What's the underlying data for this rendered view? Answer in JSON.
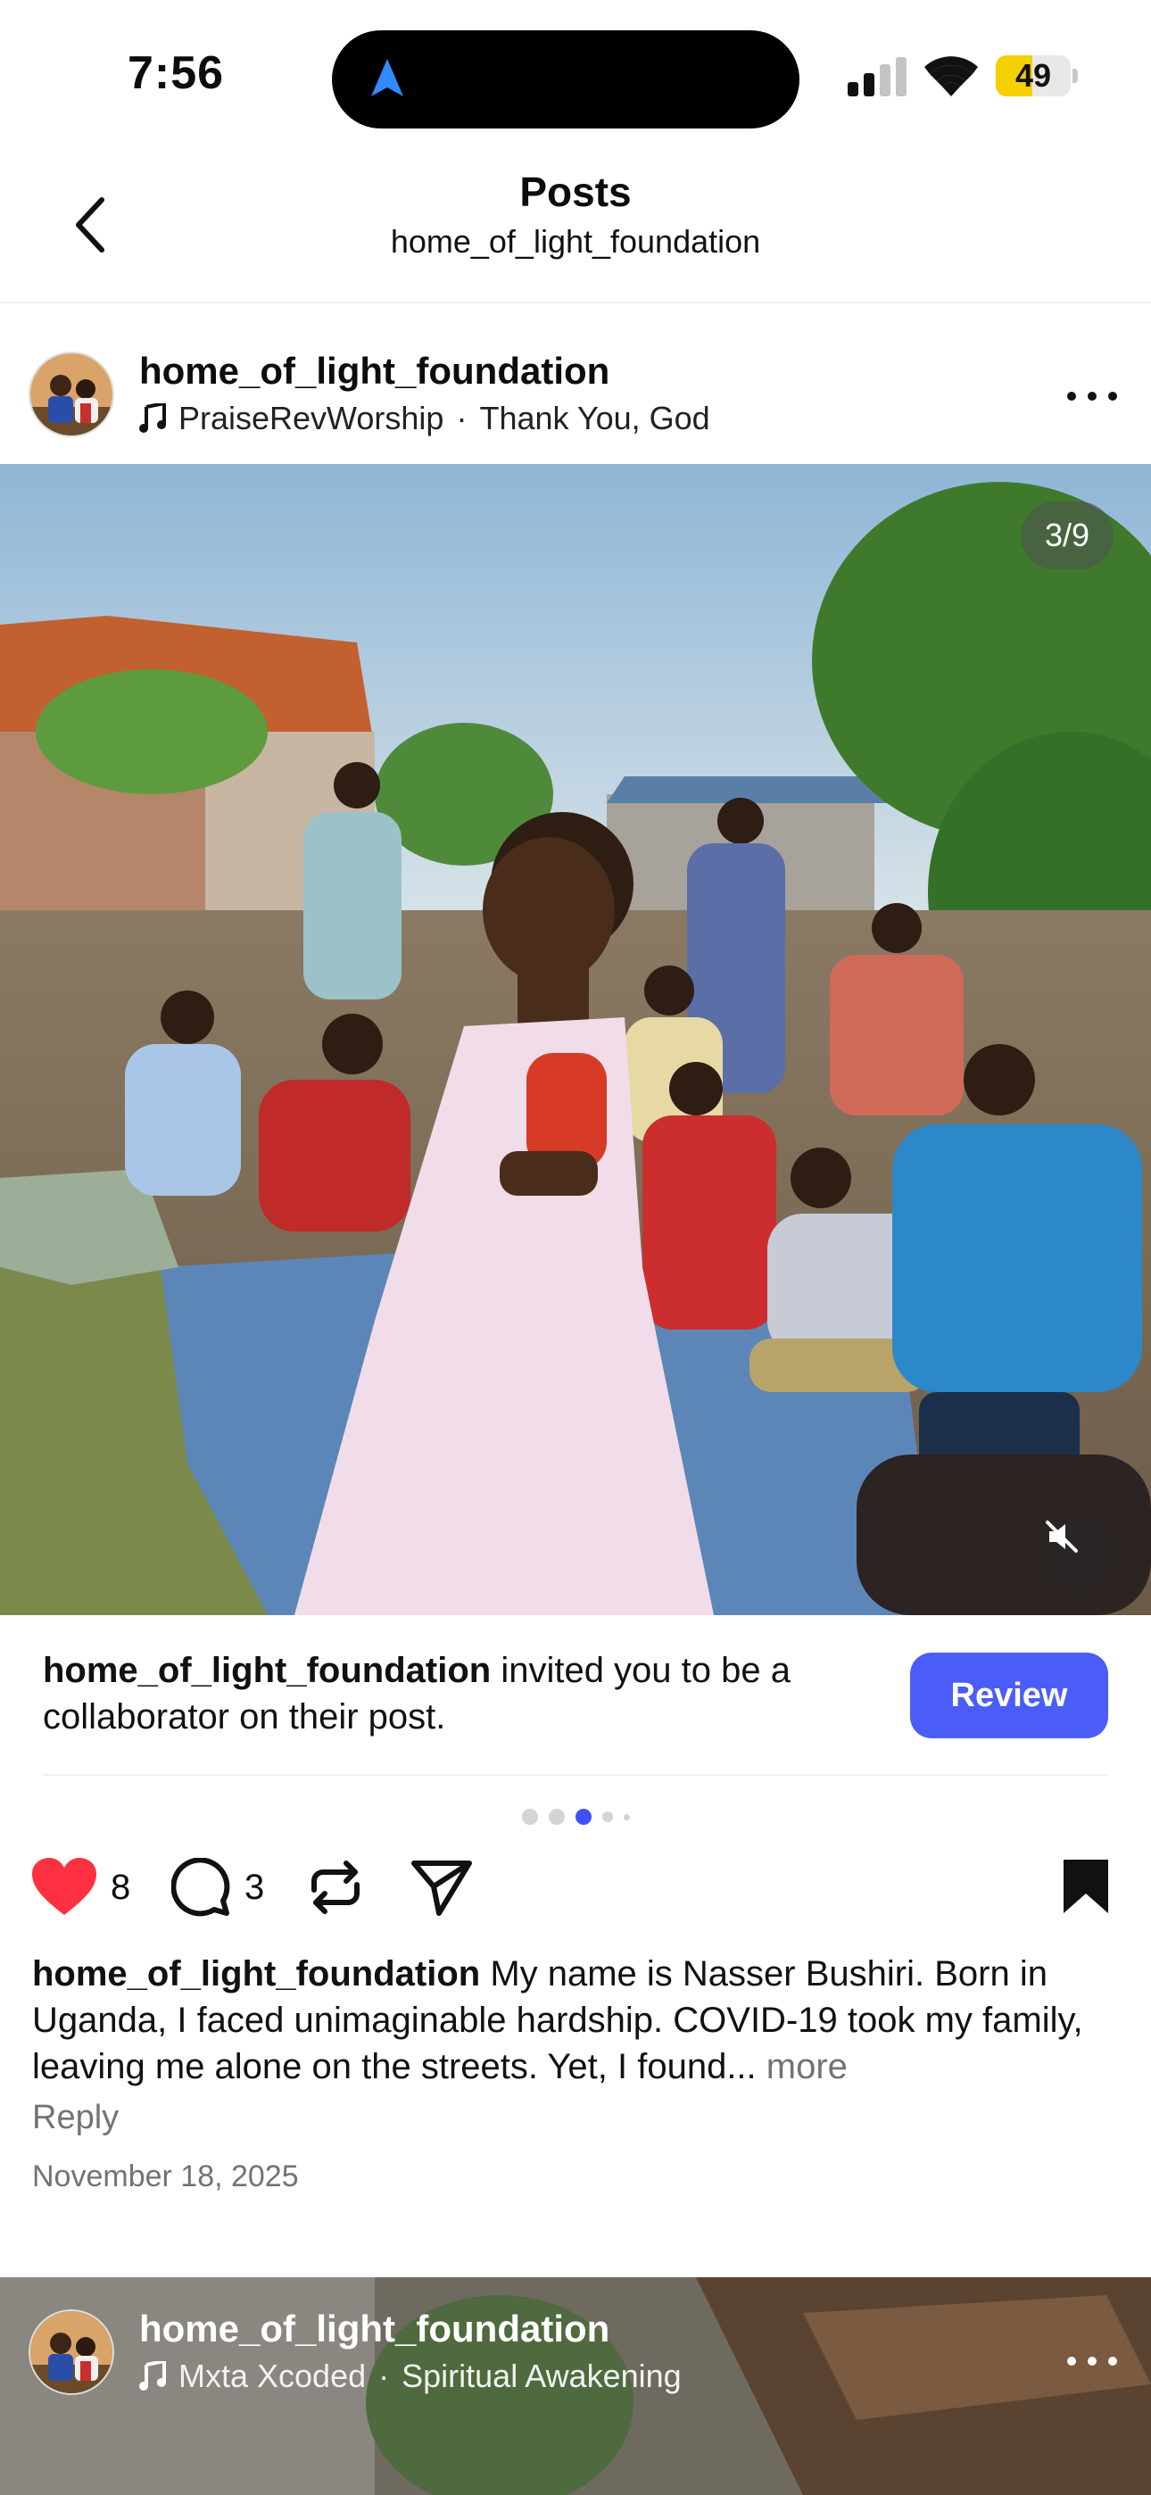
{
  "status_bar": {
    "time": "7:56",
    "battery_level": "49",
    "battery_fraction": 0.49
  },
  "header": {
    "title": "Posts",
    "subtitle": "home_of_light_foundation"
  },
  "post": {
    "username": "home_of_light_foundation",
    "music_artist": "PraiseRevWorship",
    "music_separator": "·",
    "music_title": "Thank You, God",
    "image_counter": "3/9",
    "carousel": {
      "total": 5,
      "active_index": 2
    },
    "collab_user": "home_of_light_foundation",
    "collab_text": "invited you to be a collaborator on their post.",
    "review_label": "Review",
    "likes": "8",
    "comments": "3",
    "caption_user": "home_of_light_foundation",
    "caption_text": "My name is Nasser Bushiri. Born in Uganda, I faced unimaginable hardship. COVID-19 took my family, leaving me alone on the streets. Yet, I found...",
    "caption_more": "more",
    "reply_label": "Reply",
    "date": "November 18, 2025"
  },
  "next_post": {
    "username": "home_of_light_foundation",
    "music_artist": "Mxta Xcoded",
    "music_separator": "·",
    "music_title": "Spiritual Awakening"
  },
  "colors": {
    "accent": "#4a5df9",
    "like": "#ff3040",
    "battery": "#f5d000",
    "secondary_text": "#737373"
  },
  "icons": {
    "back": "chevron-left-icon",
    "music": "music-note-icon",
    "more": "ellipsis-icon",
    "mute": "speaker-muted-icon",
    "like": "heart-icon",
    "comment": "comment-bubble-icon",
    "repost": "repost-icon",
    "share": "paper-plane-icon",
    "save": "bookmark-icon"
  }
}
